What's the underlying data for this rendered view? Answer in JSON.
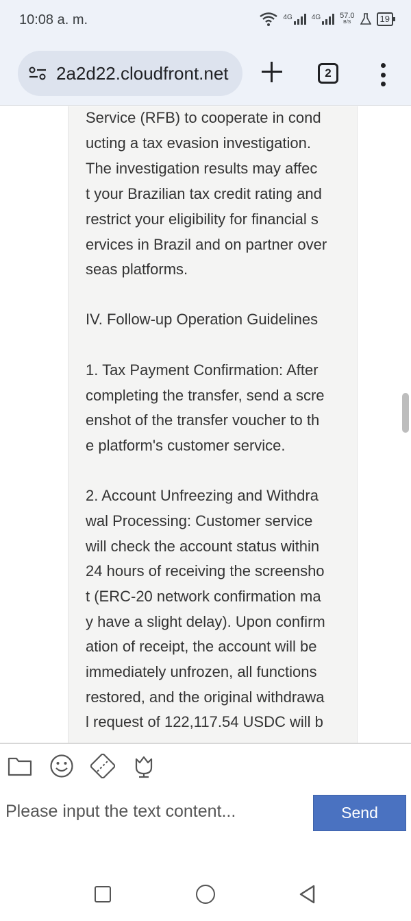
{
  "status_bar": {
    "time": "10:08 a. m.",
    "network_1": "4G",
    "network_2": "4G",
    "speed_value": "57.0",
    "speed_unit": "B/S",
    "battery": "19",
    "icons": [
      "wifi-icon",
      "signal-icon",
      "signal-icon",
      "flask-icon",
      "battery-icon"
    ]
  },
  "browser": {
    "url": "2a2d22.cloudfront.net",
    "tab_count": "2",
    "icons": [
      "site-settings-icon",
      "new-tab-icon",
      "tab-switcher-icon",
      "more-menu-icon"
    ]
  },
  "message": {
    "lines": [
      "Service (RFB) to cooperate in cond",
      "ucting a tax evasion investigation.",
      "The investigation results may affec",
      "t your Brazilian tax credit rating and",
      "restrict your eligibility for financial s",
      "ervices in Brazil and on partner over",
      "seas platforms.",
      "IV. Follow-up Operation Guidelines",
      "1. Tax Payment Confirmation: After",
      "completing the transfer, send a scre",
      "enshot of the transfer voucher to th",
      "e platform's customer service.",
      "2. Account Unfreezing and Withdra",
      "wal Processing: Customer service",
      "will check the account status within",
      "24 hours of receiving the screensho",
      "t (ERC-20 network confirmation ma",
      "y have a slight delay). Upon confirm",
      "ation of receipt, the account will be",
      "immediately unfrozen, all functions",
      "restored, and the original withdrawa",
      "l request of 122,117.54 USDC will b"
    ]
  },
  "composer": {
    "placeholder": "Please input the text content...",
    "send_label": "Send",
    "tools": [
      "folder-icon",
      "emoji-icon",
      "image-icon",
      "flower-icon"
    ]
  },
  "colors": {
    "send_button": "#4a72c1",
    "bubble_bg": "#f4f4f3",
    "browser_bar": "#eef2f9"
  }
}
